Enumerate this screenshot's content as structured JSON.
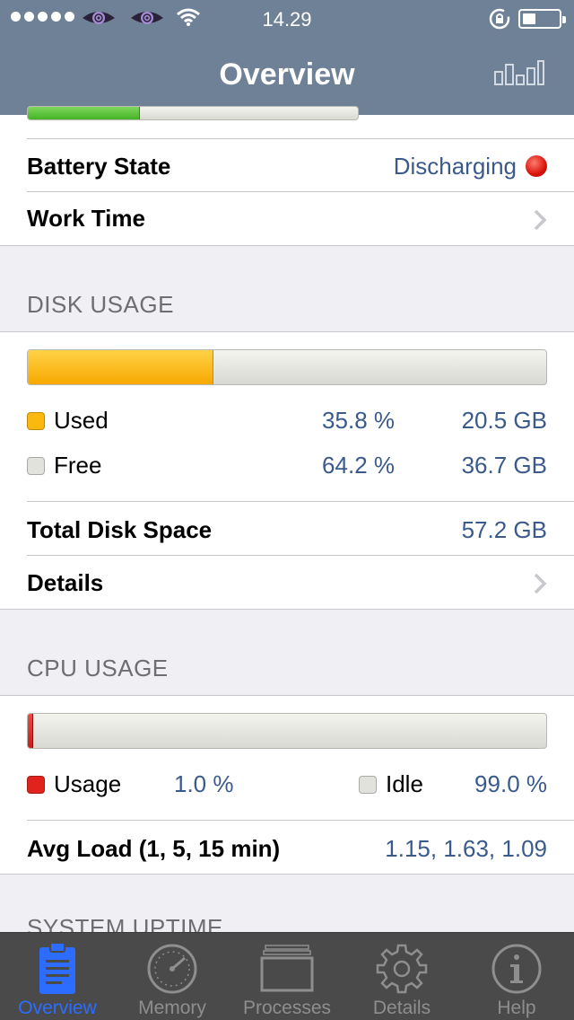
{
  "status_bar": {
    "time": "14.29"
  },
  "nav": {
    "title": "Overview"
  },
  "battery_section": {
    "level_fraction": 0.34,
    "state_label": "Battery State",
    "state_value": "Discharging",
    "state_color": "#e0231d",
    "work_time_label": "Work Time"
  },
  "disk": {
    "header": "DISK USAGE",
    "used_fraction": 0.358,
    "used_label": "Used",
    "used_percent": "35.8 %",
    "used_size": "20.5 GB",
    "free_label": "Free",
    "free_percent": "64.2 %",
    "free_size": "36.7 GB",
    "total_label": "Total Disk Space",
    "total_value": "57.2 GB",
    "details_label": "Details",
    "used_color": "#fbb80f",
    "free_color": "#e2e2dc"
  },
  "cpu": {
    "header": "CPU USAGE",
    "usage_fraction": 0.01,
    "usage_label": "Usage",
    "usage_value": "1.0 %",
    "idle_label": "Idle",
    "idle_value": "99.0 %",
    "avg_label": "Avg Load (1, 5, 15 min)",
    "avg_value": "1.15, 1.63, 1.09",
    "usage_color": "#e0231d",
    "idle_color": "#e2e2dc"
  },
  "uptime_header": "SYSTEM UPTIME",
  "tabs": [
    {
      "label": "Overview",
      "icon": "clipboard-icon",
      "active": true
    },
    {
      "label": "Memory",
      "icon": "gauge-icon",
      "active": false
    },
    {
      "label": "Processes",
      "icon": "stack-icon",
      "active": false
    },
    {
      "label": "Details",
      "icon": "gear-icon",
      "active": false
    },
    {
      "label": "Help",
      "icon": "info-icon",
      "active": false
    }
  ],
  "colors": {
    "accent": "#2c6dff",
    "navbar": "#6f8196",
    "value_text": "#3a5a8c"
  }
}
